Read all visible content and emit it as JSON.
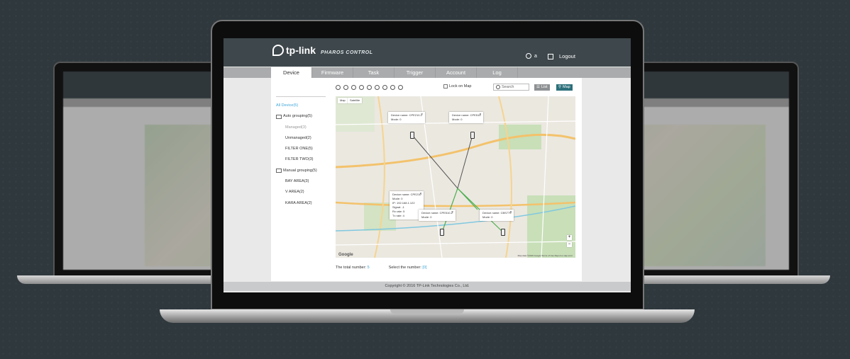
{
  "brand": {
    "logo_text": "tp-link",
    "product": "PHAROS CONTROL"
  },
  "header": {
    "user": "a",
    "logout": "Logout"
  },
  "tabs": [
    "Device",
    "Firmware",
    "Task",
    "Trigger",
    "Account",
    "Log"
  ],
  "active_tab": "Device",
  "toolbar": {
    "lock_label": "Lock on Map",
    "search_placeholder": "Search",
    "list_label": "List",
    "map_label": "Map"
  },
  "tree": {
    "all": "All Device(5)",
    "auto": "Auto grouping(5)",
    "auto_children": [
      "Managed(3)",
      "Unmanaged(2)",
      "FILTER ONE(5)",
      "FILTER TWO(3)"
    ],
    "manual": "Manual grouping(5)",
    "manual_children": [
      "BAY AREA(3)",
      "V AREA(2)",
      "KARA AREA(2)"
    ]
  },
  "map": {
    "tab_map": "Map",
    "tab_satellite": "Satellite",
    "google": "Google",
    "attribution": "Map data ©2016 Google   Terms of Use   Report a map error",
    "popups": [
      {
        "lines": [
          "Device name: CPE210-1",
          "Mode: 0"
        ]
      },
      {
        "lines": [
          "Device name: CPE510",
          "Mode: 0"
        ]
      },
      {
        "lines": [
          "Device name: CPE210",
          "Mode: 0",
          "IP: 192.168.1.122",
          "Signal: -1",
          "Rx rate: 5",
          "Tx rate: 4"
        ]
      },
      {
        "lines": [
          "Device name: CPE510-2",
          "Mode: 0"
        ]
      },
      {
        "lines": [
          "Device name: CBS779",
          "Mode: 0"
        ]
      }
    ]
  },
  "footer": {
    "total_label": "The total number:",
    "total_value": "5",
    "select_label": "Select the number:",
    "select_value": "[0]"
  },
  "copyright": "Copyright © 2016 TP-Link Technologies Co., Ltd.",
  "colors": {
    "header": "#3e474c",
    "accent": "#3fa7d6",
    "map_btn": "#2c6f7a"
  }
}
